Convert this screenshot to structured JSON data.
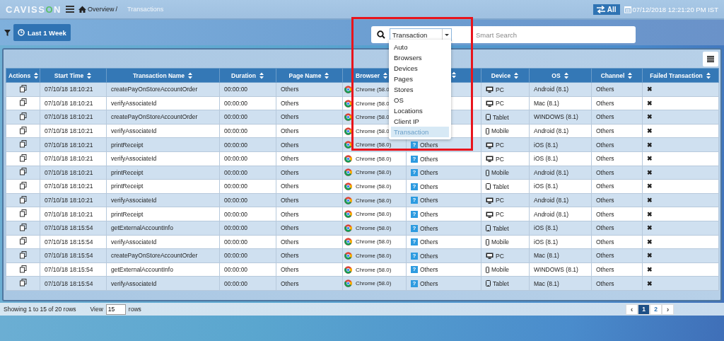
{
  "header": {
    "logo": [
      "CAVISS",
      "O",
      "N"
    ],
    "breadcrumb": [
      "Overview",
      "/",
      "Transactions"
    ],
    "mode_button": "All",
    "datetime": "07/12/2018 12:21:20 PM IST"
  },
  "toolbar": {
    "time_button": "Last 1 Week"
  },
  "search": {
    "category": "Transaction",
    "placeholder": "Smart Search",
    "options": [
      {
        "label": "Auto",
        "selected": false
      },
      {
        "label": "Browsers",
        "selected": false
      },
      {
        "label": "Devices",
        "selected": false
      },
      {
        "label": "Pages",
        "selected": false
      },
      {
        "label": "Stores",
        "selected": false
      },
      {
        "label": "OS",
        "selected": false
      },
      {
        "label": "Locations",
        "selected": false
      },
      {
        "label": "Client IP",
        "selected": false
      },
      {
        "label": "Transaction",
        "selected": true
      }
    ]
  },
  "table": {
    "columns": [
      "Actions",
      "Start Time",
      "Transaction Name",
      "Duration",
      "Page Name",
      "Browser",
      null,
      "Device",
      "OS",
      "Channel",
      "Failed Transaction"
    ],
    "rows": [
      {
        "start": "07/10/18 18:10:21",
        "name": "createPayOnStoreAccountOrder",
        "duration": "00:00:00",
        "page": "Others",
        "browser": "Chrome (58.0",
        "location": null,
        "device": {
          "label": "PC",
          "kind": "pc"
        },
        "os": "Android (8.1)",
        "channel": "Others",
        "failed": "✖"
      },
      {
        "start": "07/10/18 18:10:21",
        "name": "verifyAssociateId",
        "duration": "00:00:00",
        "page": "Others",
        "browser": "Chrome (58.0",
        "location": null,
        "device": {
          "label": "PC",
          "kind": "pc"
        },
        "os": "Mac (8.1)",
        "channel": "Others",
        "failed": "✖"
      },
      {
        "start": "07/10/18 18:10:21",
        "name": "createPayOnStoreAccountOrder",
        "duration": "00:00:00",
        "page": "Others",
        "browser": "Chrome (58.0",
        "location": null,
        "device": {
          "label": "Tablet",
          "kind": "tablet"
        },
        "os": "WINDOWS (8.1)",
        "channel": "Others",
        "failed": "✖"
      },
      {
        "start": "07/10/18 18:10:21",
        "name": "verifyAssociateId",
        "duration": "00:00:00",
        "page": "Others",
        "browser": "Chrome (58.0",
        "location": null,
        "device": {
          "label": "Mobile",
          "kind": "mobile"
        },
        "os": "Android (8.1)",
        "channel": "Others",
        "failed": "✖"
      },
      {
        "start": "07/10/18 18:10:21",
        "name": "printReceipt",
        "duration": "00:00:00",
        "page": "Others",
        "browser": "Chrome (58.0)",
        "location": {
          "icon": "?",
          "label": "Others"
        },
        "device": {
          "label": "PC",
          "kind": "pc"
        },
        "os": "iOS (8.1)",
        "channel": "Others",
        "failed": "✖"
      },
      {
        "start": "07/10/18 18:10:21",
        "name": "verifyAssociateId",
        "duration": "00:00:00",
        "page": "Others",
        "browser": "Chrome (58.0)",
        "location": {
          "icon": "?",
          "label": "Others"
        },
        "device": {
          "label": "PC",
          "kind": "pc"
        },
        "os": "iOS (8.1)",
        "channel": "Others",
        "failed": "✖"
      },
      {
        "start": "07/10/18 18:10:21",
        "name": "printReceipt",
        "duration": "00:00:00",
        "page": "Others",
        "browser": "Chrome (58.0)",
        "location": {
          "icon": "?",
          "label": "Others"
        },
        "device": {
          "label": "Mobile",
          "kind": "mobile"
        },
        "os": "Android (8.1)",
        "channel": "Others",
        "failed": "✖"
      },
      {
        "start": "07/10/18 18:10:21",
        "name": "printReceipt",
        "duration": "00:00:00",
        "page": "Others",
        "browser": "Chrome (58.0)",
        "location": {
          "icon": "?",
          "label": "Others"
        },
        "device": {
          "label": "Tablet",
          "kind": "tablet"
        },
        "os": "iOS (8.1)",
        "channel": "Others",
        "failed": "✖"
      },
      {
        "start": "07/10/18 18:10:21",
        "name": "verifyAssociateId",
        "duration": "00:00:00",
        "page": "Others",
        "browser": "Chrome (58.0)",
        "location": {
          "icon": "?",
          "label": "Others"
        },
        "device": {
          "label": "PC",
          "kind": "pc"
        },
        "os": "Android (8.1)",
        "channel": "Others",
        "failed": "✖"
      },
      {
        "start": "07/10/18 18:10:21",
        "name": "printReceipt",
        "duration": "00:00:00",
        "page": "Others",
        "browser": "Chrome (58.0)",
        "location": {
          "icon": "?",
          "label": "Others"
        },
        "device": {
          "label": "PC",
          "kind": "pc"
        },
        "os": "Android (8.1)",
        "channel": "Others",
        "failed": "✖"
      },
      {
        "start": "07/10/18 18:15:54",
        "name": "getExternalAccountInfo",
        "duration": "00:00:00",
        "page": "Others",
        "browser": "Chrome (58.0)",
        "location": {
          "icon": "?",
          "label": "Others"
        },
        "device": {
          "label": "Tablet",
          "kind": "tablet"
        },
        "os": "iOS (8.1)",
        "channel": "Others",
        "failed": "✖"
      },
      {
        "start": "07/10/18 18:15:54",
        "name": "verifyAssociateId",
        "duration": "00:00:00",
        "page": "Others",
        "browser": "Chrome (58.0)",
        "location": {
          "icon": "?",
          "label": "Others"
        },
        "device": {
          "label": "Mobile",
          "kind": "mobile"
        },
        "os": "iOS (8.1)",
        "channel": "Others",
        "failed": "✖"
      },
      {
        "start": "07/10/18 18:15:54",
        "name": "createPayOnStoreAccountOrder",
        "duration": "00:00:00",
        "page": "Others",
        "browser": "Chrome (58.0)",
        "location": {
          "icon": "?",
          "label": "Others"
        },
        "device": {
          "label": "PC",
          "kind": "pc"
        },
        "os": "Mac (8.1)",
        "channel": "Others",
        "failed": "✖"
      },
      {
        "start": "07/10/18 18:15:54",
        "name": "getExternalAccountInfo",
        "duration": "00:00:00",
        "page": "Others",
        "browser": "Chrome (58.0)",
        "location": {
          "icon": "?",
          "label": "Others"
        },
        "device": {
          "label": "Mobile",
          "kind": "mobile"
        },
        "os": "WINDOWS (8.1)",
        "channel": "Others",
        "failed": "✖"
      },
      {
        "start": "07/10/18 18:15:54",
        "name": "verifyAssociateId",
        "duration": "00:00:00",
        "page": "Others",
        "browser": "Chrome (58.0)",
        "location": {
          "icon": "?",
          "label": "Others"
        },
        "device": {
          "label": "Tablet",
          "kind": "tablet"
        },
        "os": "Mac (8.1)",
        "channel": "Others",
        "failed": "✖"
      }
    ]
  },
  "footer": {
    "summary": "Showing 1 to 15 of 20 rows",
    "view_label": "View",
    "page_size": "15",
    "rows_label": "rows",
    "pages": [
      {
        "label": "‹",
        "kind": "prev",
        "selected": false
      },
      {
        "label": "1",
        "kind": "page",
        "selected": true
      },
      {
        "label": "2",
        "kind": "page",
        "selected": false
      },
      {
        "label": "›",
        "kind": "next",
        "selected": false
      }
    ]
  }
}
